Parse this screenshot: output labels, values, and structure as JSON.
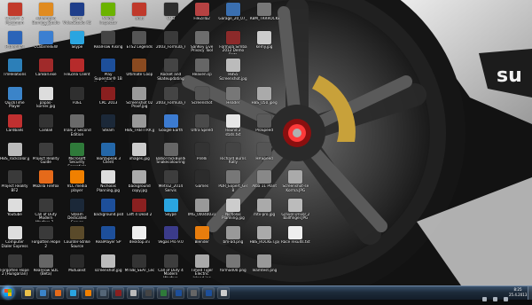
{
  "desktop": {
    "icons": [
      {
        "label": "Crysis® 2 Maximum Edition",
        "color": "#c23a2b",
        "col": 0,
        "row": 0
      },
      {
        "label": "Ashampoo Burning Studio 2012",
        "color": "#e08b20",
        "col": 1,
        "row": 0
      },
      {
        "label": "Corel VideoStudio X5",
        "color": "#1f3e8a",
        "col": 2,
        "row": 0
      },
      {
        "label": "Nvidia Inspector",
        "color": "#6bb300",
        "col": 3,
        "row": 0
      },
      {
        "label": "addt",
        "color": "#c0392b",
        "col": 4,
        "row": 0
      },
      {
        "label": "CQB",
        "color": "#2d2d2d",
        "col": 5,
        "row": 0
      },
      {
        "label": "FileZilla2",
        "color": "#b64242",
        "col": 6,
        "row": 0
      },
      {
        "label": "Garage_20_07_2012",
        "color": "#3a6fb0",
        "col": 7,
        "row": 0
      },
      {
        "label": "RBM_TRRROCKET",
        "color": "#777777",
        "col": 8,
        "row": 0
      },
      {
        "label": "Prufeninal",
        "color": "#2b64b8",
        "col": 0,
        "row": 1
      },
      {
        "label": "CCBarrenEW",
        "color": "#3b7fd1",
        "col": 1,
        "row": 1
      },
      {
        "label": "Skype",
        "color": "#2aa5e0",
        "col": 2,
        "row": 1
      },
      {
        "label": "RealFlow Rising",
        "color": "#444444",
        "col": 3,
        "row": 1
      },
      {
        "label": "ETS2 Legends",
        "color": "#555555",
        "col": 4,
        "row": 1
      },
      {
        "label": "2003_Formula_ACCFT4",
        "color": "#3a3a3a",
        "col": 5,
        "row": 1
      },
      {
        "label": "SanKey Live Privacy Tool",
        "color": "#6d6d6d",
        "col": 6,
        "row": 1
      },
      {
        "label": "Formula Simba 2012 Demo Beta",
        "color": "#8c2a2a",
        "col": 7,
        "row": 1
      },
      {
        "label": "kemy.jpg",
        "color": "#cccccc",
        "col": 8,
        "row": 1
      },
      {
        "label": "TmRelations",
        "color": "#2c7fb8",
        "col": 0,
        "row": 2
      },
      {
        "label": "CarBall.exe",
        "color": "#a02a2a",
        "col": 1,
        "row": 2
      },
      {
        "label": "FileZilla Client",
        "color": "#b62b2b",
        "col": 2,
        "row": 2
      },
      {
        "label": "Play Superstar® 1B Next Challenge",
        "color": "#1d4f9a",
        "col": 3,
        "row": 2
      },
      {
        "label": "Ultimate Coop",
        "color": "#8a4a20",
        "col": 4,
        "row": 2
      },
      {
        "label": "Rocket and Skateupdating",
        "color": "#444444",
        "col": 5,
        "row": 2
      },
      {
        "label": "Heaven.sp",
        "color": "#666666",
        "col": 6,
        "row": 2
      },
      {
        "label": "HBS5 Screenshot.jpg",
        "color": "#bbbbbb",
        "col": 7,
        "row": 2
      },
      {
        "label": "QuickTime Player",
        "color": "#3b84c9",
        "col": 0,
        "row": 3
      },
      {
        "label": "papas-korner.jpg",
        "color": "#dddddd",
        "col": 1,
        "row": 3
      },
      {
        "label": "FUEL",
        "color": "#2f2f2f",
        "col": 2,
        "row": 3
      },
      {
        "label": "CRC 2013",
        "color": "#8a1f1f",
        "col": 3,
        "row": 3
      },
      {
        "label": "Screenshot 02 Proof.jpg",
        "color": "#9a9a9a",
        "col": 4,
        "row": 3
      },
      {
        "label": "2003_Formula_Alfa",
        "color": "#444444",
        "col": 5,
        "row": 3
      },
      {
        "label": "Screenshot",
        "color": "#555555",
        "col": 6,
        "row": 3
      },
      {
        "label": "Header",
        "color": "#777777",
        "col": 7,
        "row": 3
      },
      {
        "label": "HBS_050.jpeg",
        "color": "#aaaaaa",
        "col": 8,
        "row": 3
      },
      {
        "label": "Cardballs",
        "color": "#c03030",
        "col": 0,
        "row": 4
      },
      {
        "label": "CarBall",
        "color": "#333333",
        "col": 1,
        "row": 4
      },
      {
        "label": "Trials 2 Second Edition",
        "color": "#6a6a6a",
        "col": 2,
        "row": 4
      },
      {
        "label": "Steam",
        "color": "#1b2838",
        "col": 3,
        "row": 4
      },
      {
        "label": "HBS_TRBTTRR.jpg",
        "color": "#999999",
        "col": 4,
        "row": 4
      },
      {
        "label": "Google Earth",
        "color": "#3c7bd0",
        "col": 5,
        "row": 4
      },
      {
        "label": "Ultra Speed",
        "color": "#4a4a4a",
        "col": 6,
        "row": 4
      },
      {
        "label": "Round 2 stats.txt",
        "color": "#e6e6e6",
        "col": 7,
        "row": 4
      },
      {
        "label": "ProSpeed",
        "color": "#5a5a5a",
        "col": 8,
        "row": 4
      },
      {
        "label": "HBS_rockcolor.jpg",
        "color": "#bbbbbb",
        "col": 0,
        "row": 5
      },
      {
        "label": "Project Reality Guide",
        "color": "#3d3d3d",
        "col": 1,
        "row": 5
      },
      {
        "label": "Microsoft Security Essentials",
        "color": "#2f7a3a",
        "col": 2,
        "row": 5
      },
      {
        "label": "TeamSpeak 3 Client",
        "color": "#2467a8",
        "col": 3,
        "row": 5
      },
      {
        "label": "images.jpg",
        "color": "#cccccc",
        "col": 4,
        "row": 5
      },
      {
        "label": "BoboTrackBuilder... Snakecolouring",
        "color": "#666666",
        "col": 5,
        "row": 5
      },
      {
        "label": "Pirelli",
        "color": "#333333",
        "col": 6,
        "row": 5
      },
      {
        "label": "Richard Burns Rally",
        "color": "#444444",
        "col": 7,
        "row": 5
      },
      {
        "label": "HP.Speed",
        "color": "#555555",
        "col": 8,
        "row": 5
      },
      {
        "label": "Project Reality BF2",
        "color": "#3a3a3a",
        "col": 0,
        "row": 6
      },
      {
        "label": "Mozilla Firefox",
        "color": "#e56a1a",
        "col": 1,
        "row": 6
      },
      {
        "label": "VLC media player",
        "color": "#f08000",
        "col": 2,
        "row": 6
      },
      {
        "label": "Nicholas Planning.jpg",
        "color": "#dddddd",
        "col": 3,
        "row": 6
      },
      {
        "label": "background copy.jpg",
        "color": "#aaaaaa",
        "col": 4,
        "row": 6
      },
      {
        "label": "Metro2_2014 Servis",
        "color": "#3d3d3d",
        "col": 5,
        "row": 6
      },
      {
        "label": "Games",
        "color": "#2c2c2c",
        "col": 6,
        "row": 6
      },
      {
        "label": "PDR_Expert_GRC-8",
        "color": "#777777",
        "col": 7,
        "row": 6
      },
      {
        "label": "Alba 11 Plant",
        "color": "#888888",
        "col": 8,
        "row": 6
      },
      {
        "label": "Screenshot-se Korma.JPG",
        "color": "#aaaaaa",
        "col": 9,
        "row": 6
      },
      {
        "label": "Youtube",
        "color": "#dddddd",
        "col": 0,
        "row": 7
      },
      {
        "label": "Call of Duty Modern Warfare 2 - Multiplayer",
        "color": "#3a3a3a",
        "col": 1,
        "row": 7
      },
      {
        "label": "Steam Dedicated Server",
        "color": "#1b2838",
        "col": 2,
        "row": 7
      },
      {
        "label": "background.psd",
        "color": "#1d4f9a",
        "col": 3,
        "row": 7
      },
      {
        "label": "Left 4 Dead 2",
        "color": "#8a2020",
        "col": 4,
        "row": 7
      },
      {
        "label": "Skype",
        "color": "#2aa5e0",
        "col": 5,
        "row": 7
      },
      {
        "label": "IMG_00040031",
        "color": "#999999",
        "col": 6,
        "row": 7
      },
      {
        "label": "Nicholas Planning.jpg",
        "color": "#cccccc",
        "col": 7,
        "row": 7
      },
      {
        "label": "mtv-pro.jpg",
        "color": "#aaaaaa",
        "col": 8,
        "row": 7
      },
      {
        "label": "Gravel Driver 2 Ballfinger.JPG",
        "color": "#bbbbbb",
        "col": 9,
        "row": 7
      },
      {
        "label": "Computer Dialer Express",
        "color": "#dddddd",
        "col": 0,
        "row": 8
      },
      {
        "label": "Forgotten Hope 2",
        "color": "#3a3a3a",
        "col": 1,
        "row": 8
      },
      {
        "label": "Counter-Strike Source",
        "color": "#5a4a2a",
        "col": 2,
        "row": 8
      },
      {
        "label": "RealPlayer SP",
        "color": "#1d4f9a",
        "col": 3,
        "row": 8
      },
      {
        "label": "desktop.ini",
        "color": "#eeeeee",
        "col": 4,
        "row": 8
      },
      {
        "label": "Vegas Pro 9.0",
        "color": "#3b3b8a",
        "col": 5,
        "row": 8
      },
      {
        "label": "Blender",
        "color": "#e87d0d",
        "col": 6,
        "row": 8
      },
      {
        "label": "bm-ad.png",
        "color": "#999999",
        "col": 7,
        "row": 8
      },
      {
        "label": "HBS_ROCKET.jpg",
        "color": "#aaaaaa",
        "col": 8,
        "row": 8
      },
      {
        "label": "Race results.txt",
        "color": "#eeeeee",
        "col": 9,
        "row": 8
      },
      {
        "label": "Forgotten Hope 2 (Hungarian)",
        "color": "#3a3a3a",
        "col": 0,
        "row": 9
      },
      {
        "label": "RealFlow SDL (Beta)",
        "color": "#666666",
        "col": 1,
        "row": 9
      },
      {
        "label": "Mutualist",
        "color": "#2a2a2a",
        "col": 2,
        "row": 9
      },
      {
        "label": "screenshot.jpg",
        "color": "#bbbbbb",
        "col": 3,
        "row": 9
      },
      {
        "label": "MTBB_SEAT_Leon_Multipoli",
        "color": "#333333",
        "col": 4,
        "row": 9
      },
      {
        "label": "Call of Duty 4 Modern Warfare",
        "color": "#3d3d3d",
        "col": 5,
        "row": 9
      },
      {
        "label": "Timed Tiger Electric Island.jpg",
        "color": "#aaaaaa",
        "col": 6,
        "row": 9
      },
      {
        "label": "forma400.png",
        "color": "#777777",
        "col": 7,
        "row": 9
      },
      {
        "label": "Teamtest.png",
        "color": "#999999",
        "col": 8,
        "row": 9
      }
    ]
  },
  "taskbar": {
    "pinned": [
      {
        "name": "explorer",
        "color": "#e8c04a"
      },
      {
        "name": "media",
        "color": "#3b84c9"
      },
      {
        "name": "firefox",
        "color": "#e56a1a"
      },
      {
        "name": "skype",
        "color": "#2aa5e0"
      },
      {
        "name": "vlc",
        "color": "#f08000"
      },
      {
        "name": "steam",
        "color": "#556677"
      },
      {
        "name": "app7",
        "color": "#8a2020"
      },
      {
        "name": "app8",
        "color": "#bbbbbb"
      },
      {
        "name": "app9",
        "color": "#444444"
      },
      {
        "name": "app10",
        "color": "#2f7a3a"
      },
      {
        "name": "photoshop1",
        "color": "#1d4f9a"
      },
      {
        "name": "app12",
        "color": "#666666"
      },
      {
        "name": "photoshop2",
        "color": "#1d4f9a"
      },
      {
        "name": "app14",
        "color": "#cccccc"
      }
    ],
    "clock": {
      "time": "8:25",
      "date": "25.4.2013"
    }
  }
}
